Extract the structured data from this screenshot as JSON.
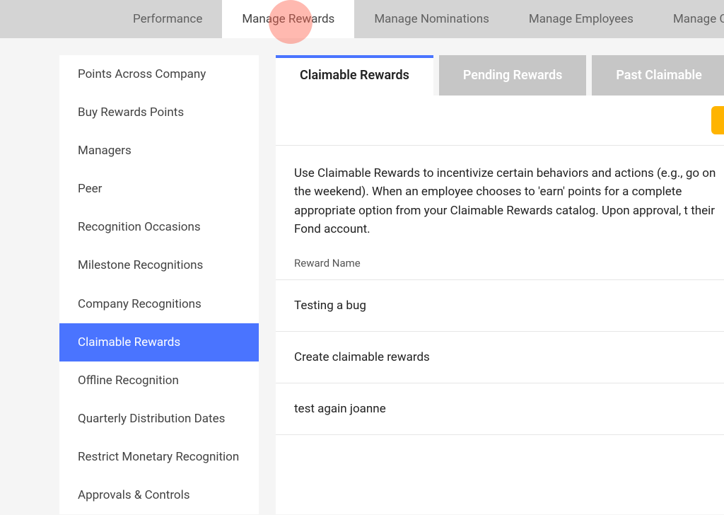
{
  "topnav": {
    "items": [
      {
        "label": "Performance",
        "active": false
      },
      {
        "label": "Manage Rewards",
        "active": true
      },
      {
        "label": "Manage Nominations",
        "active": false
      },
      {
        "label": "Manage Employees",
        "active": false
      },
      {
        "label": "Manage Ca",
        "active": false
      }
    ]
  },
  "sidebar": {
    "items": [
      {
        "label": "Points Across Company",
        "active": false
      },
      {
        "label": "Buy Rewards Points",
        "active": false
      },
      {
        "label": "Managers",
        "active": false
      },
      {
        "label": "Peer",
        "active": false
      },
      {
        "label": "Recognition Occasions",
        "active": false
      },
      {
        "label": "Milestone Recognitions",
        "active": false
      },
      {
        "label": "Company Recognitions",
        "active": false
      },
      {
        "label": "Claimable Rewards",
        "active": true
      },
      {
        "label": "Offline Recognition",
        "active": false
      },
      {
        "label": "Quarterly Distribution Dates",
        "active": false
      },
      {
        "label": "Restrict Monetary Recognition",
        "active": false
      },
      {
        "label": "Approvals & Controls",
        "active": false
      }
    ]
  },
  "tabs": {
    "items": [
      {
        "label": "Claimable Rewards",
        "active": true
      },
      {
        "label": "Pending Rewards",
        "active": false
      },
      {
        "label": "Past Claimable",
        "active": false
      }
    ]
  },
  "main": {
    "description": "Use Claimable Rewards to incentivize certain behaviors and actions (e.g., go on the weekend). When an employee chooses to 'earn' points for a complete appropriate option from your Claimable Rewards catalog. Upon approval, t their Fond account.",
    "column_header": "Reward Name",
    "rows": [
      {
        "name": "Testing a bug"
      },
      {
        "name": "Create claimable rewards"
      },
      {
        "name": "test again joanne"
      }
    ]
  }
}
